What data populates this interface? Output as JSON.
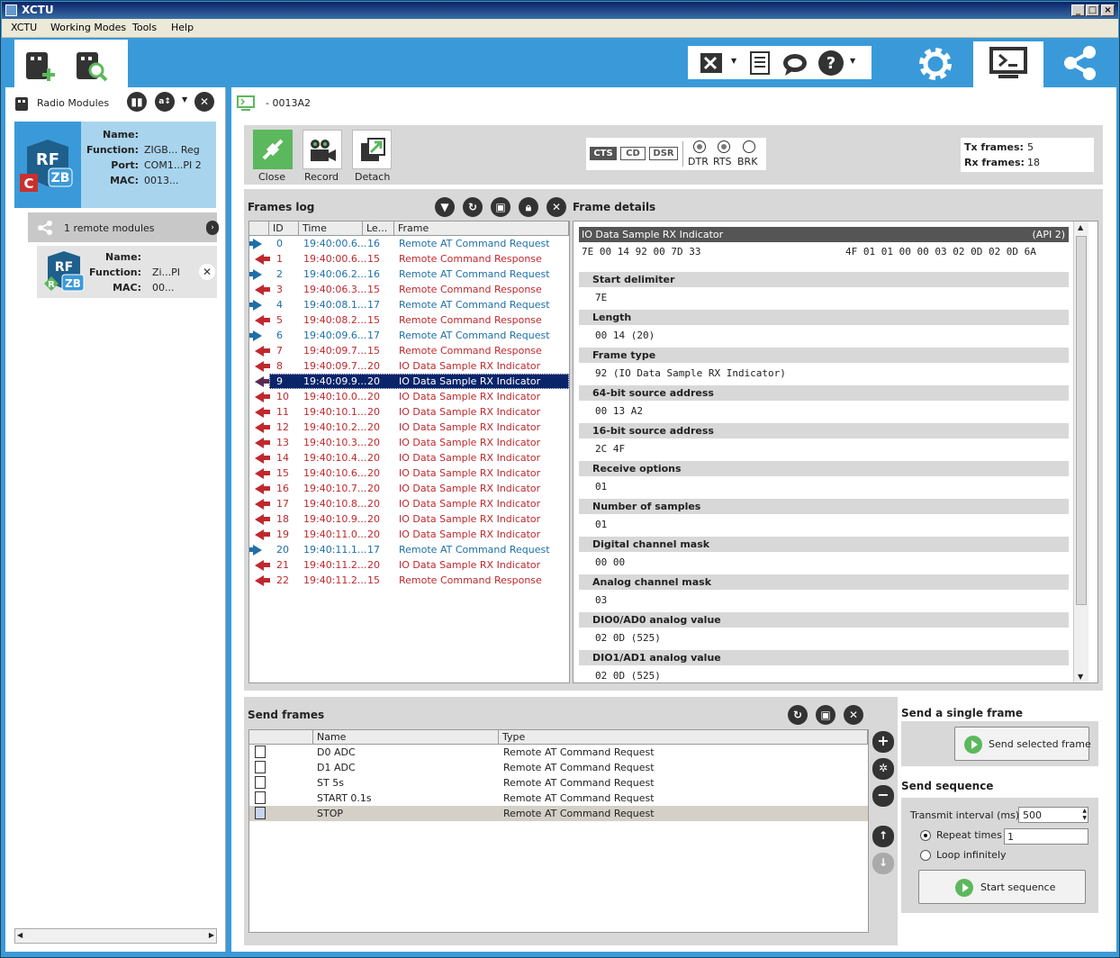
{
  "app": {
    "title": "XCTU",
    "menus": [
      "XCTU",
      "Working Modes",
      "Tools",
      "Help"
    ]
  },
  "left": {
    "title": "Radio Modules",
    "local": {
      "name_label": "Name:",
      "function_label": "Function:",
      "port_label": "Port:",
      "mac_label": "MAC:",
      "name": "",
      "function": "ZIGB... Reg",
      "port": "COM1...PI 2",
      "mac": "0013..."
    },
    "remote_header": "1 remote modules",
    "remote": {
      "name_label": "Name:",
      "function_label": "Function:",
      "mac_label": "MAC:",
      "name": "",
      "function": "Zi...PI",
      "mac": "00..."
    }
  },
  "console": {
    "tab_title": "- 0013A2",
    "buttons": {
      "close": "Close",
      "record": "Record",
      "detach": "Detach"
    },
    "lines": {
      "cts": "CTS",
      "cd": "CD",
      "dsr": "DSR",
      "dtr": "DTR",
      "rts": "RTS",
      "brk": "BRK"
    },
    "tx_label": "Tx frames:",
    "tx": "5",
    "rx_label": "Rx frames:",
    "rx": "18"
  },
  "frames_log": {
    "title": "Frames log",
    "columns": [
      "ID",
      "Time",
      "Le...",
      "Frame"
    ],
    "rows": [
      {
        "dir": "out",
        "id": "0",
        "time": "19:40:00.6...",
        "len": "16",
        "frame": "Remote AT Command Request"
      },
      {
        "dir": "in",
        "id": "1",
        "time": "19:40:00.6...",
        "len": "15",
        "frame": "Remote Command Response"
      },
      {
        "dir": "out",
        "id": "2",
        "time": "19:40:06.2...",
        "len": "16",
        "frame": "Remote AT Command Request"
      },
      {
        "dir": "in",
        "id": "3",
        "time": "19:40:06.3...",
        "len": "15",
        "frame": "Remote Command Response"
      },
      {
        "dir": "out",
        "id": "4",
        "time": "19:40:08.1...",
        "len": "17",
        "frame": "Remote AT Command Request"
      },
      {
        "dir": "in",
        "id": "5",
        "time": "19:40:08.2...",
        "len": "15",
        "frame": "Remote Command Response"
      },
      {
        "dir": "out",
        "id": "6",
        "time": "19:40:09.6...",
        "len": "17",
        "frame": "Remote AT Command Request"
      },
      {
        "dir": "in",
        "id": "7",
        "time": "19:40:09.7...",
        "len": "15",
        "frame": "Remote Command Response"
      },
      {
        "dir": "in",
        "id": "8",
        "time": "19:40:09.7...",
        "len": "20",
        "frame": "IO Data Sample RX Indicator"
      },
      {
        "dir": "in",
        "id": "9",
        "time": "19:40:09.9...",
        "len": "20",
        "frame": "IO Data Sample RX Indicator",
        "selected": true
      },
      {
        "dir": "in",
        "id": "10",
        "time": "19:40:10.0...",
        "len": "20",
        "frame": "IO Data Sample RX Indicator"
      },
      {
        "dir": "in",
        "id": "11",
        "time": "19:40:10.1...",
        "len": "20",
        "frame": "IO Data Sample RX Indicator"
      },
      {
        "dir": "in",
        "id": "12",
        "time": "19:40:10.2...",
        "len": "20",
        "frame": "IO Data Sample RX Indicator"
      },
      {
        "dir": "in",
        "id": "13",
        "time": "19:40:10.3...",
        "len": "20",
        "frame": "IO Data Sample RX Indicator"
      },
      {
        "dir": "in",
        "id": "14",
        "time": "19:40:10.4...",
        "len": "20",
        "frame": "IO Data Sample RX Indicator"
      },
      {
        "dir": "in",
        "id": "15",
        "time": "19:40:10.6...",
        "len": "20",
        "frame": "IO Data Sample RX Indicator"
      },
      {
        "dir": "in",
        "id": "16",
        "time": "19:40:10.7...",
        "len": "20",
        "frame": "IO Data Sample RX Indicator"
      },
      {
        "dir": "in",
        "id": "17",
        "time": "19:40:10.8...",
        "len": "20",
        "frame": "IO Data Sample RX Indicator"
      },
      {
        "dir": "in",
        "id": "18",
        "time": "19:40:10.9...",
        "len": "20",
        "frame": "IO Data Sample RX Indicator"
      },
      {
        "dir": "in",
        "id": "19",
        "time": "19:40:11.0...",
        "len": "20",
        "frame": "IO Data Sample RX Indicator"
      },
      {
        "dir": "out",
        "id": "20",
        "time": "19:40:11.1...",
        "len": "17",
        "frame": "Remote AT Command Request"
      },
      {
        "dir": "in",
        "id": "21",
        "time": "19:40:11.2...",
        "len": "20",
        "frame": "IO Data Sample RX Indicator"
      },
      {
        "dir": "in",
        "id": "22",
        "time": "19:40:11.2...",
        "len": "15",
        "frame": "Remote Command Response"
      }
    ]
  },
  "frame_details": {
    "title": "Frame details",
    "frame_name": "IO Data Sample RX Indicator",
    "api": "(API 2)",
    "hex_left": "7E 00 14 92 00 7D 33",
    "hex_right": "4F 01 01 00 00 03 02 0D 02 0D 6A",
    "fields": [
      {
        "label": "Start delimiter",
        "value": "7E"
      },
      {
        "label": "Length",
        "value": "00 14 (20)"
      },
      {
        "label": "Frame type",
        "value": "92 (IO Data Sample RX Indicator)"
      },
      {
        "label": "64-bit source address",
        "value": "00 13 A2"
      },
      {
        "label": "16-bit source address",
        "value": "2C 4F"
      },
      {
        "label": "Receive options",
        "value": "01"
      },
      {
        "label": "Number of samples",
        "value": "01"
      },
      {
        "label": "Digital channel mask",
        "value": "00 00"
      },
      {
        "label": "Analog channel mask",
        "value": "03"
      },
      {
        "label": "DIO0/AD0 analog value",
        "value": "02 0D (525)"
      },
      {
        "label": "DIO1/AD1 analog value",
        "value": "02 0D (525)"
      }
    ]
  },
  "send_frames": {
    "title": "Send frames",
    "columns": [
      "Name",
      "Type"
    ],
    "rows": [
      {
        "name": "D0 ADC",
        "type": "Remote AT Command Request"
      },
      {
        "name": "D1 ADC",
        "type": "Remote AT Command Request"
      },
      {
        "name": "ST 5s",
        "type": "Remote AT Command Request"
      },
      {
        "name": "START 0.1s",
        "type": "Remote AT Command Request"
      },
      {
        "name": "STOP",
        "type": "Remote AT Command Request",
        "selected": true
      }
    ]
  },
  "single": {
    "title": "Send a single frame",
    "button": "Send selected frame"
  },
  "sequence": {
    "title": "Send sequence",
    "interval_label": "Transmit interval (ms):",
    "interval": "500",
    "repeat_label": "Repeat times",
    "repeat_value": "1",
    "loop_label": "Loop infinitely",
    "button": "Start sequence"
  },
  "colors": {
    "accent": "#3a9ad9",
    "out_arrow": "#1f6fa8",
    "in_arrow": "#c0282d",
    "selected_row": "#0a246a"
  }
}
